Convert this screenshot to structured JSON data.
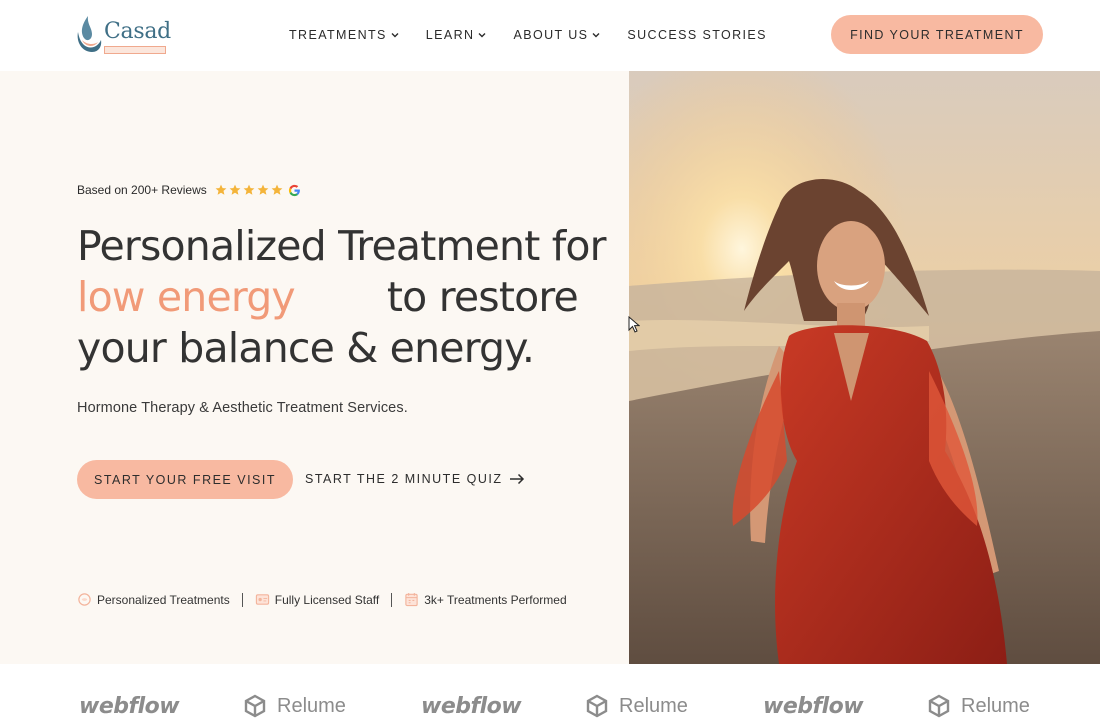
{
  "header": {
    "logo_text": "Casad",
    "nav": [
      {
        "label": "TREATMENTS",
        "has_dropdown": true
      },
      {
        "label": "LEARN",
        "has_dropdown": true
      },
      {
        "label": "ABOUT US",
        "has_dropdown": true
      },
      {
        "label": "SUCCESS STORIES",
        "has_dropdown": false
      }
    ],
    "cta_label": "FIND YOUR TREATMENT"
  },
  "hero": {
    "reviews_text": "Based on 200+ Reviews",
    "rating_stars": 5,
    "headline_line1": "Personalized Treatment for",
    "headline_accent": "low energy",
    "headline_line2_rest": "to restore",
    "headline_line3": "your balance & energy.",
    "subheading": "Hormone Therapy & Aesthetic Treatment Services.",
    "primary_button": "START YOUR FREE VISIT",
    "secondary_link": "START THE 2 MINUTE QUIZ",
    "features": [
      {
        "label": "Personalized Treatments",
        "icon": "personalized-icon"
      },
      {
        "label": "Fully Licensed Staff",
        "icon": "license-icon"
      },
      {
        "label": "3k+ Treatments Performed",
        "icon": "calendar-icon"
      }
    ]
  },
  "logo_strip": [
    {
      "name": "webflow",
      "type": "webflow"
    },
    {
      "name": "Relume",
      "type": "relume"
    },
    {
      "name": "webflow",
      "type": "webflow"
    },
    {
      "name": "Relume",
      "type": "relume"
    },
    {
      "name": "webflow",
      "type": "webflow"
    },
    {
      "name": "Relume",
      "type": "relume"
    }
  ],
  "colors": {
    "accent": "#f19a78",
    "button_bg": "#f8b9a1",
    "hero_bg": "#fcf8f3",
    "star": "#f4b43a",
    "logo_blue": "#3f6f86"
  }
}
